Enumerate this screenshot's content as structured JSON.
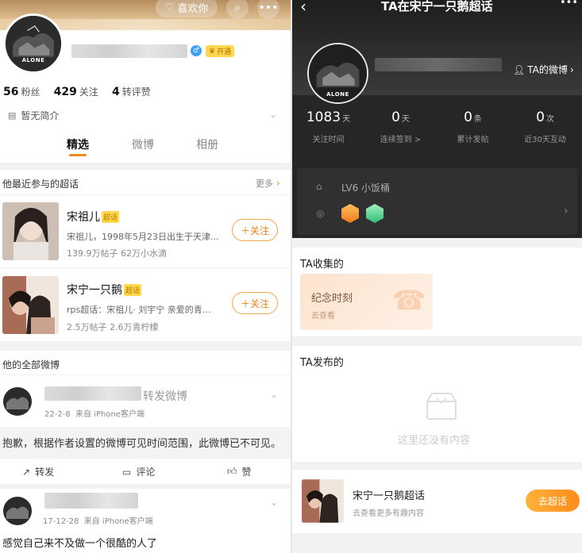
{
  "left": {
    "header": {
      "like_button": "喜欢你"
    },
    "profile": {
      "vip_badge": "开通",
      "avatar_text": "ALONE"
    },
    "stats": [
      {
        "value": "56",
        "label": "粉丝"
      },
      {
        "value": "429",
        "label": "关注"
      },
      {
        "value": "4",
        "label": "转评赞"
      }
    ],
    "bio": "暂无简介",
    "tabs": [
      "精选",
      "微博",
      "相册"
    ],
    "supertopics": {
      "title": "他最近参与的超话",
      "more": "更多",
      "tag": "超话",
      "follow_label": "关注",
      "items": [
        {
          "name": "宋祖儿",
          "desc": "宋祖儿，1998年5月23日出生于天津...",
          "meta": "139.9万帖子 62万小水滴"
        },
        {
          "name": "宋宁一只鹅",
          "desc": "rps超话：宋祖儿· 刘宇宁 亲爱的青柠...",
          "meta": "2.5万帖子 2.6万青柠檬"
        }
      ]
    },
    "posts_title": "他的全部微博",
    "post1": {
      "repost_label": "转发微博",
      "time": "22-2-8",
      "source": "来自 iPhone客户端",
      "notice": "抱歉，根据作者设置的微博可见时间范围，此微博已不可见。",
      "actions": [
        "转发",
        "评论",
        "赞"
      ]
    },
    "post2": {
      "time": "17-12-28",
      "source": "来自 iPhone客户端",
      "text": "感觉自己来不及做一个很酷的人了"
    }
  },
  "right": {
    "title": "TA在宋宁一只鹅超话",
    "weibo_link": "TA的微博",
    "avatar_text": "ALONE",
    "stats": [
      {
        "value": "1083",
        "unit": "天",
        "label": "关注时间"
      },
      {
        "value": "0",
        "unit": "天",
        "label": "连续签到 >"
      },
      {
        "value": "0",
        "unit": "条",
        "label": "累计发帖"
      },
      {
        "value": "0",
        "unit": "次",
        "label": "近30天互动"
      }
    ],
    "level": "LV6 小饭桶",
    "collected_title": "TA收集的",
    "memory_card": {
      "title": "纪念时刻",
      "sub": "去查看"
    },
    "published_title": "TA发布的",
    "empty_text": "这里还没有内容",
    "footer": {
      "name": "宋宁一只鹅超话",
      "sub": "去查看更多有趣内容",
      "button": "去超话"
    }
  },
  "colors": {
    "accent": "#f08a1c",
    "dark_header": "#262626",
    "vip": "#ffd84d"
  }
}
